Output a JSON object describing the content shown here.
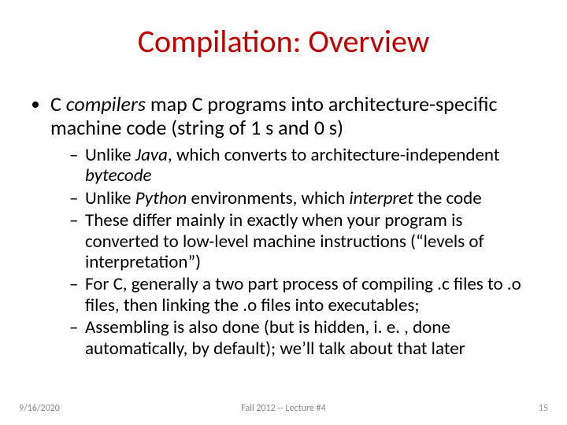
{
  "title": "Compilation: Overview",
  "bullet1": {
    "pre": "C ",
    "emph": "compilers",
    "post": " map C programs into architecture-specific machine code (string of 1 s and 0 s)"
  },
  "sub": [
    {
      "pre": "Unlike ",
      "emph": "Java",
      "mid": ", which converts to architecture-independent ",
      "emph2": "bytecode",
      "post": ""
    },
    {
      "pre": "Unlike ",
      "emph": "Python",
      "mid": " environments, which ",
      "emph2": "interpret",
      "post": " the code"
    },
    {
      "text": "These differ mainly in exactly when your program is converted to low-level machine instructions (“levels of interpretation”)"
    },
    {
      "text": "For C, generally a two part process of compiling .c files to .o files, then linking the .o files into executables;"
    },
    {
      "text": "Assembling is also done (but is hidden, i. e. , done automatically, by default); we’ll talk about that later"
    }
  ],
  "footer": {
    "date": "9/16/2020",
    "center": "Fall 2012 -- Lecture #4",
    "num": "15"
  }
}
